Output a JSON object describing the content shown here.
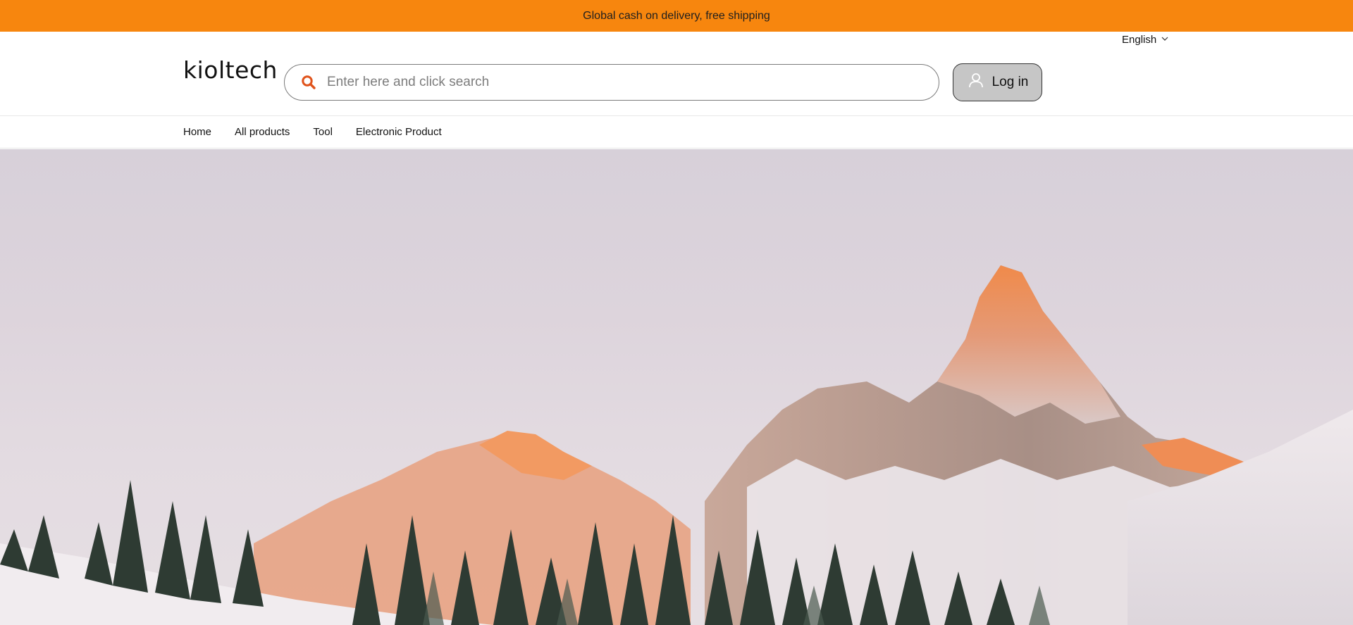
{
  "announcement": {
    "text": "Global cash on delivery, free shipping"
  },
  "language": {
    "label": "English",
    "icon": "chevron-down-icon"
  },
  "header": {
    "logo_text": "kioltech",
    "search": {
      "placeholder": "Enter here and click search",
      "value": "",
      "icon": "search-icon"
    },
    "login": {
      "label": "Log in",
      "icon": "user-icon"
    }
  },
  "nav": {
    "items": [
      {
        "label": "Home"
      },
      {
        "label": "All products"
      },
      {
        "label": "Tool"
      },
      {
        "label": "Electronic Product"
      }
    ]
  },
  "colors": {
    "announcement_bg": "#f7860e",
    "search_icon": "#e0531b",
    "login_bg": "#c6c6c6"
  },
  "hero": {
    "image": "snowy-mountain-landscape"
  }
}
